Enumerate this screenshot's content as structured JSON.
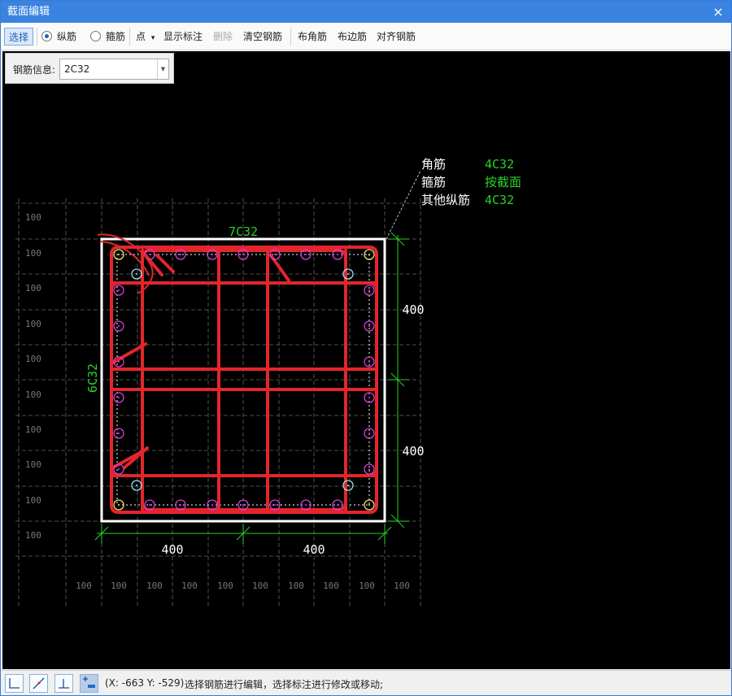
{
  "window": {
    "title": "截面编辑",
    "close_glyph": "×"
  },
  "toolbar": {
    "select": "选择",
    "radio_longitudinal": "纵筋",
    "radio_stirrup": "箍筋",
    "point": "点",
    "point_arrow": "▾",
    "show_annotation": "显示标注",
    "delete": "删除",
    "clear_rebar": "清空钢筋",
    "corner_rebar": "布角筋",
    "edge_rebar": "布边筋",
    "align_rebar": "对齐钢筋"
  },
  "rebar_info": {
    "label": "钢筋信息:",
    "value": "2C32",
    "arrow": "▼"
  },
  "drawing": {
    "legend": [
      {
        "key": "角筋",
        "value": "4C32"
      },
      {
        "key": "箍筋",
        "value": "按截面"
      },
      {
        "key": "其他纵筋",
        "value": "4C32"
      }
    ],
    "top_label": "7C32",
    "left_label": "6C32",
    "dim_right_top": "400",
    "dim_right_bottom": "400",
    "dim_bottom_left": "400",
    "dim_bottom_right": "400",
    "grid_label": "100",
    "colors": {
      "stirrup": "#e3262b",
      "dim": "#29d12a",
      "rebar": "#d83cd8",
      "grid": "#666666"
    }
  },
  "statusbar": {
    "coords": "(X: -663 Y: -529)",
    "message": "选择钢筋进行编辑，选择标注进行修改或移动;"
  }
}
